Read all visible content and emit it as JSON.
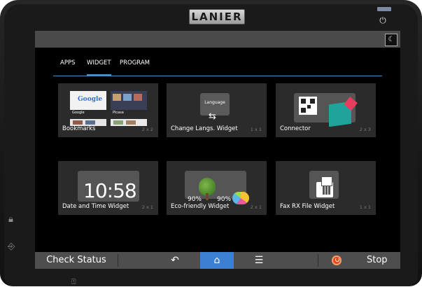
{
  "device": {
    "brand": "LANIER"
  },
  "tabs": [
    {
      "label": "APPS",
      "active": false
    },
    {
      "label": "WIDGET",
      "active": true
    },
    {
      "label": "PROGRAM",
      "active": false
    }
  ],
  "widgets": [
    {
      "label": "Bookmarks",
      "size": "2 x 2",
      "google": "Google",
      "picasa": "Picasa"
    },
    {
      "label": "Change Langs. Widget",
      "size": "1 x 1",
      "badge": "Language"
    },
    {
      "label": "Connector",
      "size": "2 x 3"
    },
    {
      "label": "Date and Time Widget",
      "size": "2 x 1",
      "time": "10:58"
    },
    {
      "label": "Eco-friendly Widget",
      "size": "2 x 1",
      "pct1": "90%",
      "pct2": "90%"
    },
    {
      "label": "Fax RX File Widget",
      "size": "1 x 1"
    }
  ],
  "bottom": {
    "check_status": "Check Status",
    "stop": "Stop"
  },
  "colors": {
    "accent": "#3d7fd3",
    "tab_underline": "#4b8fbf",
    "tile_bg": "#2b2b2b",
    "stop": "#e24a1c"
  }
}
